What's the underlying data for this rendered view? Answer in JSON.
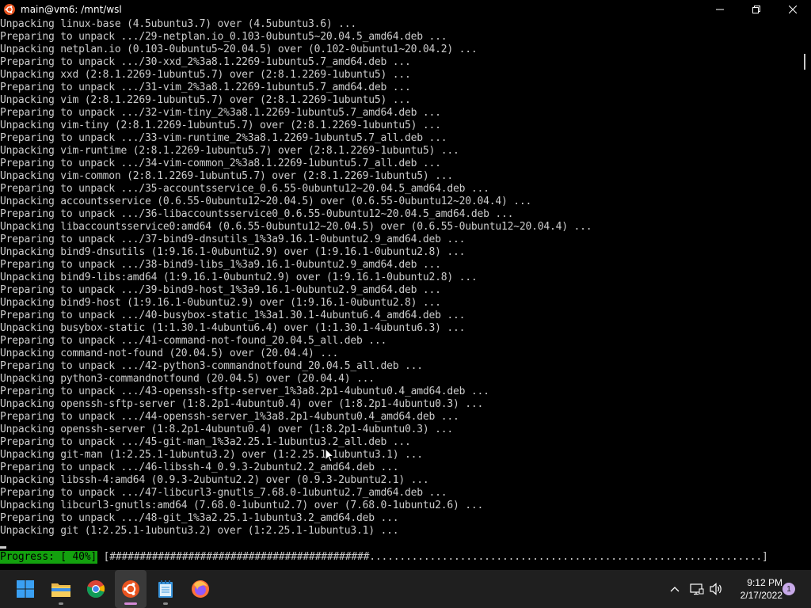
{
  "window": {
    "title": "main@vm6: /mnt/wsl"
  },
  "terminal": {
    "lines": [
      "Unpacking linux-base (4.5ubuntu3.7) over (4.5ubuntu3.6) ...",
      "Preparing to unpack .../29-netplan.io_0.103-0ubuntu5~20.04.5_amd64.deb ...",
      "Unpacking netplan.io (0.103-0ubuntu5~20.04.5) over (0.102-0ubuntu1~20.04.2) ...",
      "Preparing to unpack .../30-xxd_2%3a8.1.2269-1ubuntu5.7_amd64.deb ...",
      "Unpacking xxd (2:8.1.2269-1ubuntu5.7) over (2:8.1.2269-1ubuntu5) ...",
      "Preparing to unpack .../31-vim_2%3a8.1.2269-1ubuntu5.7_amd64.deb ...",
      "Unpacking vim (2:8.1.2269-1ubuntu5.7) over (2:8.1.2269-1ubuntu5) ...",
      "Preparing to unpack .../32-vim-tiny_2%3a8.1.2269-1ubuntu5.7_amd64.deb ...",
      "Unpacking vim-tiny (2:8.1.2269-1ubuntu5.7) over (2:8.1.2269-1ubuntu5) ...",
      "Preparing to unpack .../33-vim-runtime_2%3a8.1.2269-1ubuntu5.7_all.deb ...",
      "Unpacking vim-runtime (2:8.1.2269-1ubuntu5.7) over (2:8.1.2269-1ubuntu5) ...",
      "Preparing to unpack .../34-vim-common_2%3a8.1.2269-1ubuntu5.7_all.deb ...",
      "Unpacking vim-common (2:8.1.2269-1ubuntu5.7) over (2:8.1.2269-1ubuntu5) ...",
      "Preparing to unpack .../35-accountsservice_0.6.55-0ubuntu12~20.04.5_amd64.deb ...",
      "Unpacking accountsservice (0.6.55-0ubuntu12~20.04.5) over (0.6.55-0ubuntu12~20.04.4) ...",
      "Preparing to unpack .../36-libaccountsservice0_0.6.55-0ubuntu12~20.04.5_amd64.deb ...",
      "Unpacking libaccountsservice0:amd64 (0.6.55-0ubuntu12~20.04.5) over (0.6.55-0ubuntu12~20.04.4) ...",
      "Preparing to unpack .../37-bind9-dnsutils_1%3a9.16.1-0ubuntu2.9_amd64.deb ...",
      "Unpacking bind9-dnsutils (1:9.16.1-0ubuntu2.9) over (1:9.16.1-0ubuntu2.8) ...",
      "Preparing to unpack .../38-bind9-libs_1%3a9.16.1-0ubuntu2.9_amd64.deb ...",
      "Unpacking bind9-libs:amd64 (1:9.16.1-0ubuntu2.9) over (1:9.16.1-0ubuntu2.8) ...",
      "Preparing to unpack .../39-bind9-host_1%3a9.16.1-0ubuntu2.9_amd64.deb ...",
      "Unpacking bind9-host (1:9.16.1-0ubuntu2.9) over (1:9.16.1-0ubuntu2.8) ...",
      "Preparing to unpack .../40-busybox-static_1%3a1.30.1-4ubuntu6.4_amd64.deb ...",
      "Unpacking busybox-static (1:1.30.1-4ubuntu6.4) over (1:1.30.1-4ubuntu6.3) ...",
      "Preparing to unpack .../41-command-not-found_20.04.5_all.deb ...",
      "Unpacking command-not-found (20.04.5) over (20.04.4) ...",
      "Preparing to unpack .../42-python3-commandnotfound_20.04.5_all.deb ...",
      "Unpacking python3-commandnotfound (20.04.5) over (20.04.4) ...",
      "Preparing to unpack .../43-openssh-sftp-server_1%3a8.2p1-4ubuntu0.4_amd64.deb ...",
      "Unpacking openssh-sftp-server (1:8.2p1-4ubuntu0.4) over (1:8.2p1-4ubuntu0.3) ...",
      "Preparing to unpack .../44-openssh-server_1%3a8.2p1-4ubuntu0.4_amd64.deb ...",
      "Unpacking openssh-server (1:8.2p1-4ubuntu0.4) over (1:8.2p1-4ubuntu0.3) ...",
      "Preparing to unpack .../45-git-man_1%3a2.25.1-1ubuntu3.2_all.deb ...",
      "Unpacking git-man (1:2.25.1-1ubuntu3.2) over (1:2.25.1-1ubuntu3.1) ...",
      "Preparing to unpack .../46-libssh-4_0.9.3-2ubuntu2.2_amd64.deb ...",
      "Unpacking libssh-4:amd64 (0.9.3-2ubuntu2.2) over (0.9.3-2ubuntu2.1) ...",
      "Preparing to unpack .../47-libcurl3-gnutls_7.68.0-1ubuntu2.7_amd64.deb ...",
      "Unpacking libcurl3-gnutls:amd64 (7.68.0-1ubuntu2.7) over (7.68.0-1ubuntu2.6) ...",
      "Preparing to unpack .../48-git_1%3a2.25.1-1ubuntu3.2_amd64.deb ...",
      "Unpacking git (1:2.25.1-1ubuntu3.2) over (1:2.25.1-1ubuntu3.1) ..."
    ],
    "progress_label": "Progress: [ 40%]",
    "progress_bar": " [###########################################.................................................................]",
    "progress_fraction": 0.4
  },
  "taskbar": {
    "apps": [
      {
        "name": "start-button",
        "icon": "windows-logo-icon"
      },
      {
        "name": "file-explorer",
        "icon": "folder-icon"
      },
      {
        "name": "chrome",
        "icon": "chrome-icon"
      },
      {
        "name": "ubuntu-terminal",
        "icon": "ubuntu-icon"
      },
      {
        "name": "notepad",
        "icon": "notepad-icon"
      },
      {
        "name": "firefox",
        "icon": "firefox-icon"
      }
    ],
    "clock": {
      "time": "9:12 PM",
      "date": "2/17/2022"
    },
    "notification_count": "1"
  },
  "colors": {
    "terminal_bg": "#000000",
    "terminal_fg": "#cccccc",
    "progress_green": "#13a10e",
    "taskbar_bg": "#1f1f1f",
    "ubuntu_orange": "#e95420"
  }
}
